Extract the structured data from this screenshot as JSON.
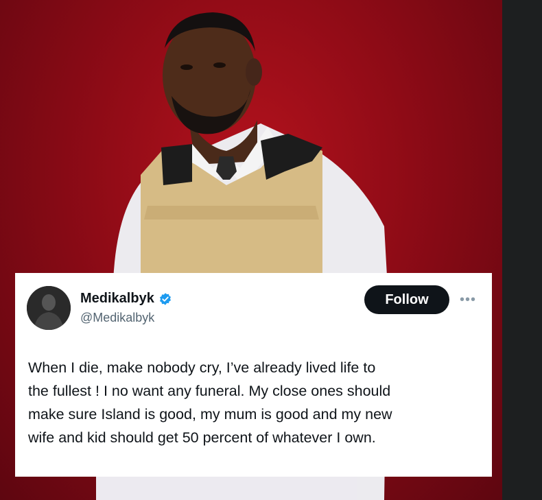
{
  "tweet": {
    "display_name": "Medikalbyk",
    "handle": "@Medikalbyk",
    "follow_label": "Follow",
    "more_label": "•••",
    "verified_icon": "verified-badge-icon",
    "lines": [
      "When I die, make nobody cry, I’ve already  lived life to",
      "the fullest ! I no want any funeral. My close ones should",
      "make sure Island is good, my mum is good and my new",
      "wife and kid should get 50 percent of whatever I own."
    ]
  },
  "colors": {
    "background_red": "#8e0b16",
    "card": "#ffffff",
    "follow_button": "#0f1419",
    "verified_blue": "#1d9bf0",
    "handle_gray": "#536471"
  }
}
